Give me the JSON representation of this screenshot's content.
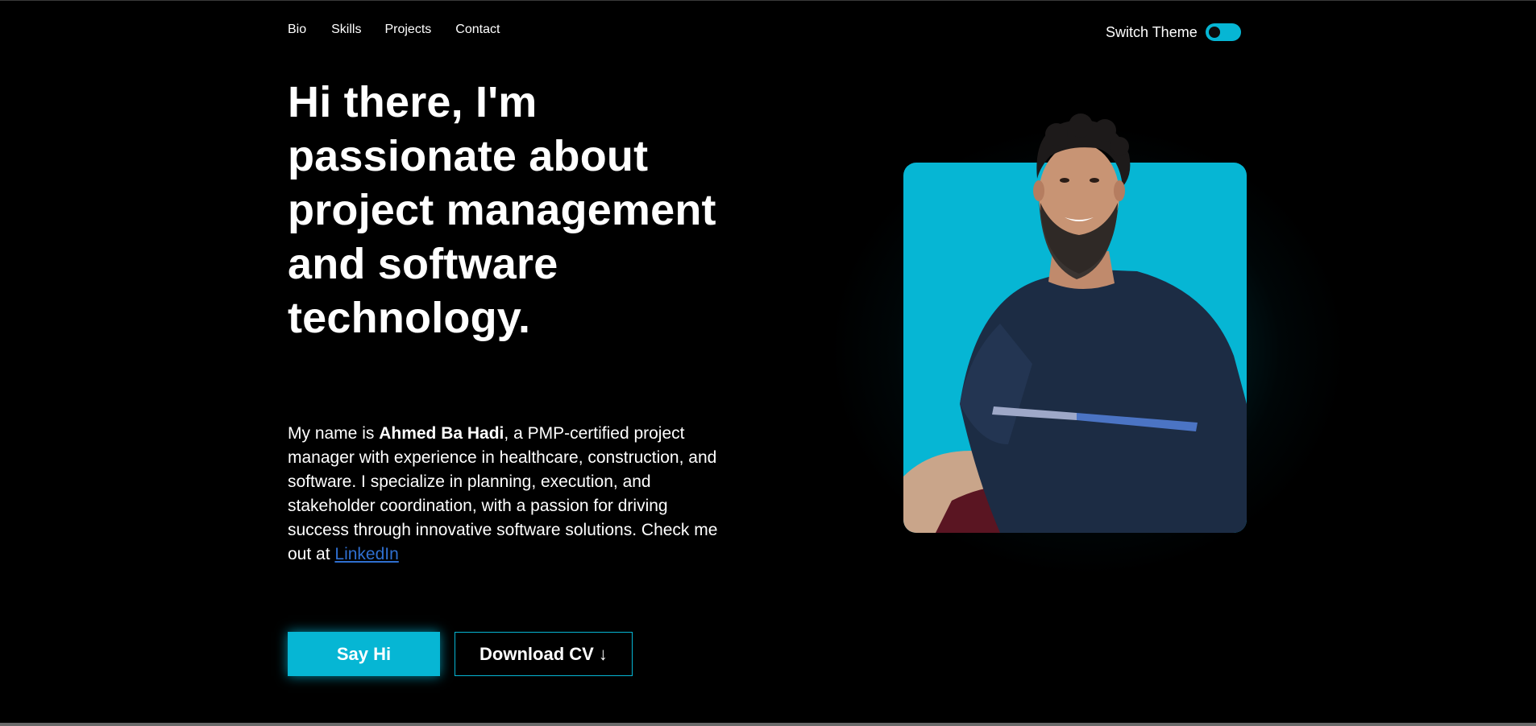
{
  "nav": {
    "items": [
      {
        "label": "Bio"
      },
      {
        "label": "Skills"
      },
      {
        "label": "Projects"
      },
      {
        "label": "Contact"
      }
    ],
    "theme_switch_label": "Switch Theme"
  },
  "hero": {
    "headline": "Hi there, I'm passionate about project management and software technology.",
    "bio": {
      "intro": "My name is ",
      "name": "Ahmed Ba Hadi",
      "body": ", a PMP-certified project manager with experience in healthcare, construction, and software. I specialize in planning, execution, and stakeholder coordination, with a passion for driving success through innovative software solutions. Check me out at ",
      "link_label": "LinkedIn"
    },
    "primary_button": "Say Hi",
    "secondary_button": "Download CV ↓"
  },
  "colors": {
    "accent": "#06b6d4",
    "background": "#000000",
    "link": "#2f6fd0"
  },
  "icons": {
    "theme_toggle": "toggle-switch-icon",
    "portrait": "profile-photo"
  }
}
